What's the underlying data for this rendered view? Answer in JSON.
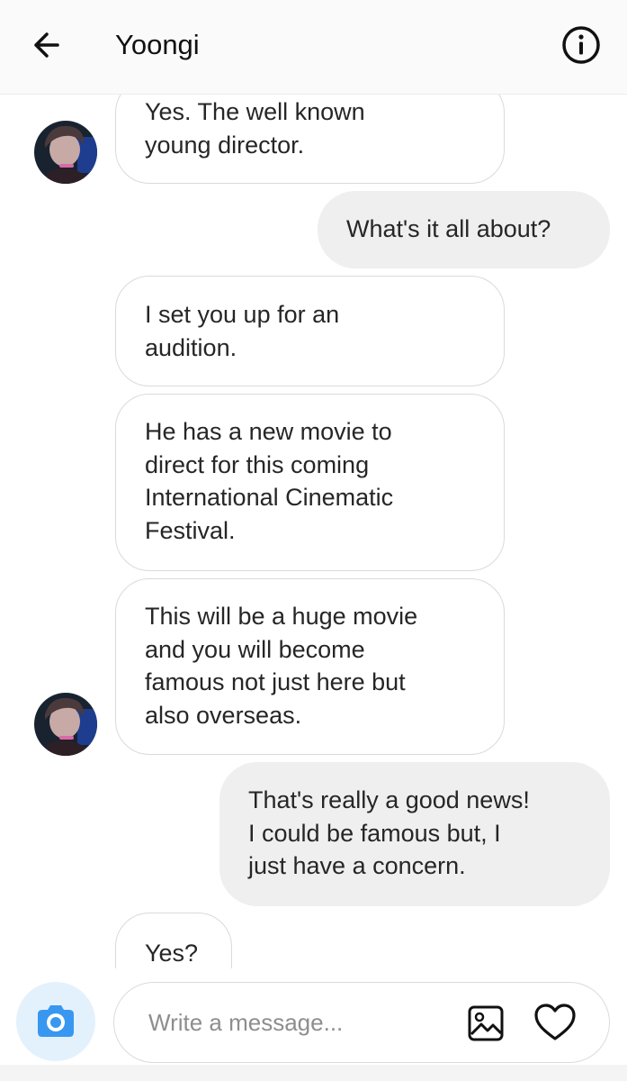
{
  "header": {
    "title": "Yoongi",
    "back_icon": "arrow-left-icon",
    "info_icon": "info-circle-icon"
  },
  "messages": [
    {
      "from": "them",
      "lines": [
        "Yes. The well known",
        "young director."
      ]
    },
    {
      "from": "me",
      "lines": [
        "What's it all about?"
      ]
    },
    {
      "from": "them",
      "lines": [
        "I set you up for an",
        "audition."
      ]
    },
    {
      "from": "them",
      "lines": [
        "He has a new movie to",
        "direct for this coming",
        "International Cinematic",
        "Festival."
      ]
    },
    {
      "from": "them",
      "lines": [
        "This will be a huge movie",
        "and you will become",
        "famous not just here but",
        "also overseas."
      ]
    },
    {
      "from": "me",
      "lines": [
        "That's really a good news!",
        "I could be famous but, I",
        "just have a concern."
      ]
    },
    {
      "from": "them",
      "lines": [
        "Yes?"
      ]
    }
  ],
  "composer": {
    "placeholder": "Write a message...",
    "camera_icon": "camera-icon",
    "gallery_icon": "image-icon",
    "like_icon": "heart-icon"
  },
  "colors": {
    "accent_blue": "#3897f0",
    "incoming_border": "#dadada",
    "outgoing_bg": "#efefef",
    "header_bg": "#fafafa"
  }
}
